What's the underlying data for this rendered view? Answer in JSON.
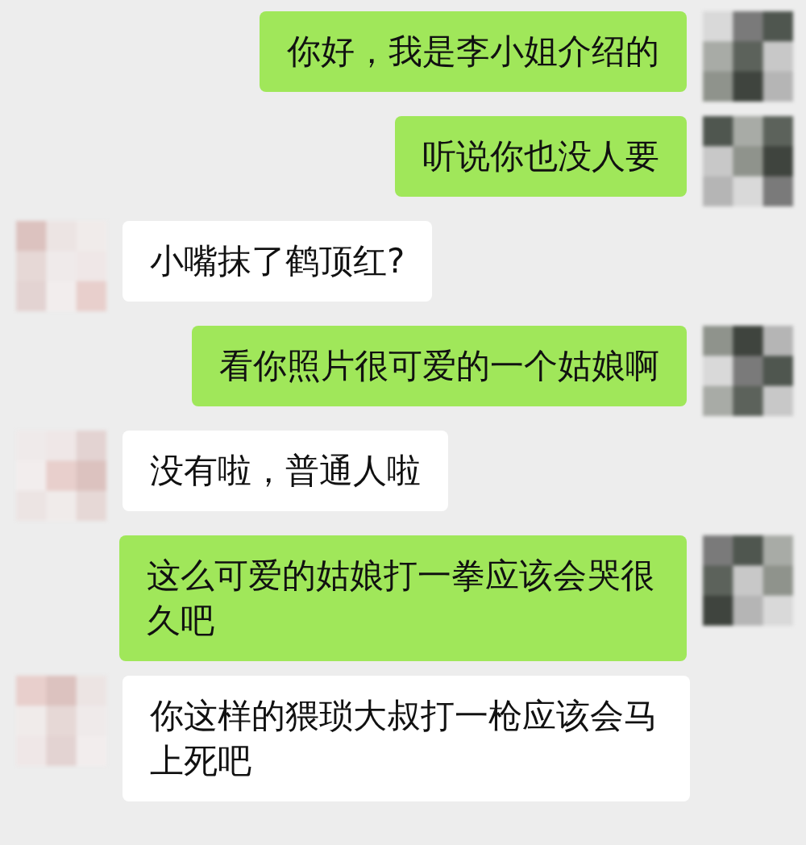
{
  "messages": [
    {
      "kind": "sent",
      "text": "你好，我是李小姐介绍的"
    },
    {
      "kind": "sent",
      "text": "听说你也没人要"
    },
    {
      "kind": "received",
      "text": "小嘴抹了鹤顶红?"
    },
    {
      "kind": "sent",
      "text": "看你照片很可爱的一个姑娘啊"
    },
    {
      "kind": "received",
      "text": "没有啦，普通人啦"
    },
    {
      "kind": "sent",
      "text": "这么可爱的姑娘打一拳应该会哭很久吧"
    },
    {
      "kind": "received",
      "text": "你这样的猥琐大叔打一枪应该会马上死吧"
    }
  ]
}
